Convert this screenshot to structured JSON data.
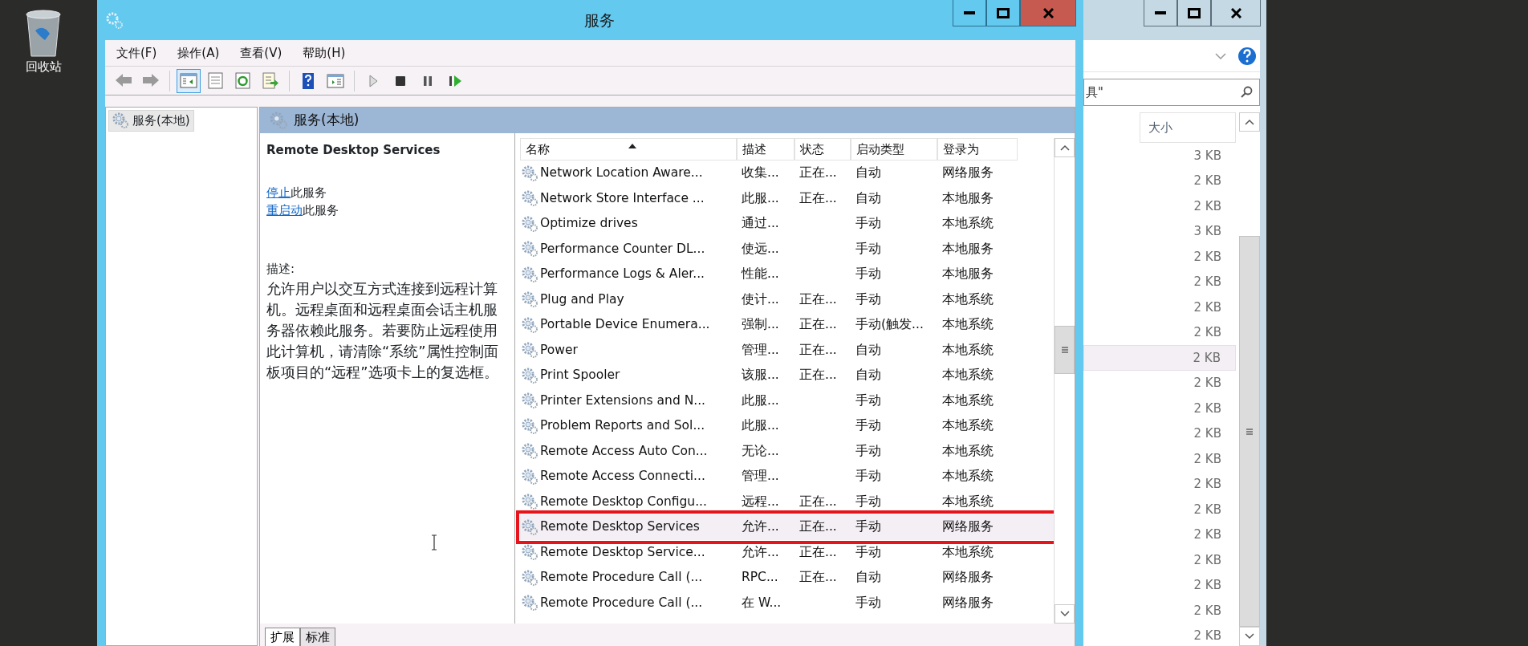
{
  "desktop": {
    "icons": [
      {
        "label": "回收站"
      }
    ]
  },
  "services_window": {
    "title": "服务",
    "menu": [
      "文件(F)",
      "操作(A)",
      "查看(V)",
      "帮助(H)"
    ],
    "toolbar": [
      {
        "kind": "back",
        "pressed": false
      },
      {
        "kind": "forward",
        "pressed": false
      },
      {
        "kind": "tree",
        "pressed": true
      },
      {
        "kind": "properties",
        "pressed": false
      },
      {
        "kind": "refresh",
        "pressed": false
      },
      {
        "kind": "export",
        "pressed": false
      },
      {
        "kind": "help",
        "pressed": false
      },
      {
        "kind": "console",
        "pressed": false
      },
      {
        "kind": "start",
        "pressed": false
      },
      {
        "kind": "stop",
        "pressed": false
      },
      {
        "kind": "pause",
        "pressed": false
      },
      {
        "kind": "resume",
        "pressed": false
      }
    ],
    "tree": [
      {
        "label": "服务(本地)",
        "selected": true
      }
    ],
    "panel_title": "服务(本地)",
    "details": {
      "service_name": "Remote Desktop Services",
      "actions": [
        {
          "link": "停止",
          "text": "此服务"
        },
        {
          "link": "重启动",
          "text": "此服务"
        }
      ],
      "description_label": "描述:",
      "description": "允许用户以交互方式连接到远程计算机。远程桌面和远程桌面会话主机服务器依赖此服务。若要防止远程使用此计算机，请清除“系统”属性控制面板项目的“远程”选项卡上的复选框。"
    },
    "table": {
      "columns": [
        {
          "label": "名称",
          "sorted": true
        },
        {
          "label": "描述",
          "sorted": false
        },
        {
          "label": "状态",
          "sorted": false
        },
        {
          "label": "启动类型",
          "sorted": false
        },
        {
          "label": "登录为",
          "sorted": false
        }
      ],
      "rows": [
        {
          "name": "Network Location Aware...",
          "description": "收集...",
          "status": "正在...",
          "startup_type": "自动",
          "log_on_as": "网络服务",
          "selected": false,
          "highlighted": false
        },
        {
          "name": "Network Store Interface ...",
          "description": "此服...",
          "status": "正在...",
          "startup_type": "自动",
          "log_on_as": "本地服务",
          "selected": false,
          "highlighted": false
        },
        {
          "name": "Optimize drives",
          "description": "通过...",
          "startup_type": "手动",
          "log_on_as": "本地系统",
          "selected": false,
          "highlighted": false
        },
        {
          "name": "Performance Counter DL...",
          "description": "使远...",
          "startup_type": "手动",
          "log_on_as": "本地服务",
          "selected": false,
          "highlighted": false
        },
        {
          "name": "Performance Logs & Aler...",
          "description": "性能...",
          "startup_type": "手动",
          "log_on_as": "本地服务",
          "selected": false,
          "highlighted": false
        },
        {
          "name": "Plug and Play",
          "description": "使计...",
          "status": "正在...",
          "startup_type": "手动",
          "log_on_as": "本地系统",
          "selected": false,
          "highlighted": false
        },
        {
          "name": "Portable Device Enumera...",
          "description": "强制...",
          "status": "正在...",
          "startup_type": "手动(触发...",
          "log_on_as": "本地系统",
          "selected": false,
          "highlighted": false
        },
        {
          "name": "Power",
          "description": "管理...",
          "status": "正在...",
          "startup_type": "自动",
          "log_on_as": "本地系统",
          "selected": false,
          "highlighted": false
        },
        {
          "name": "Print Spooler",
          "description": "该服...",
          "status": "正在...",
          "startup_type": "自动",
          "log_on_as": "本地系统",
          "selected": false,
          "highlighted": false
        },
        {
          "name": "Printer Extensions and N...",
          "description": "此服...",
          "startup_type": "手动",
          "log_on_as": "本地系统",
          "selected": false,
          "highlighted": false
        },
        {
          "name": "Problem Reports and Sol...",
          "description": "此服...",
          "startup_type": "手动",
          "log_on_as": "本地系统",
          "selected": false,
          "highlighted": false
        },
        {
          "name": "Remote Access Auto Con...",
          "description": "无论...",
          "startup_type": "手动",
          "log_on_as": "本地系统",
          "selected": false,
          "highlighted": false
        },
        {
          "name": "Remote Access Connecti...",
          "description": "管理...",
          "startup_type": "手动",
          "log_on_as": "本地系统",
          "selected": false,
          "highlighted": false
        },
        {
          "name": "Remote Desktop Configu...",
          "description": "远程...",
          "status": "正在...",
          "startup_type": "手动",
          "log_on_as": "本地系统",
          "selected": false,
          "highlighted": false
        },
        {
          "name": "Remote Desktop Services",
          "description": "允许...",
          "status": "正在...",
          "startup_type": "手动",
          "log_on_as": "网络服务",
          "selected": true,
          "highlighted": true
        },
        {
          "name": "Remote Desktop Service...",
          "description": "允许...",
          "status": "正在...",
          "startup_type": "手动",
          "log_on_as": "本地系统",
          "selected": false,
          "highlighted": false
        },
        {
          "name": "Remote Procedure Call (...",
          "description": "RPC...",
          "status": "正在...",
          "startup_type": "自动",
          "log_on_as": "网络服务",
          "selected": false,
          "highlighted": false
        },
        {
          "name": "Remote Procedure Call (...",
          "description": "在 W...",
          "startup_type": "手动",
          "log_on_as": "网络服务",
          "selected": false,
          "highlighted": false
        }
      ]
    },
    "bottom_tabs": [
      {
        "label": "扩展",
        "selected": true
      },
      {
        "label": "标准",
        "selected": false
      }
    ]
  },
  "explorer_window": {
    "search": {
      "value": "具\""
    },
    "columns": [
      "大小"
    ],
    "sizes": [
      {
        "text": "3 KB",
        "selected": false
      },
      {
        "text": "2 KB",
        "selected": false
      },
      {
        "text": "2 KB",
        "selected": false
      },
      {
        "text": "3 KB",
        "selected": false
      },
      {
        "text": "2 KB",
        "selected": false
      },
      {
        "text": "2 KB",
        "selected": false
      },
      {
        "text": "2 KB",
        "selected": false
      },
      {
        "text": "2 KB",
        "selected": false
      },
      {
        "text": "2 KB",
        "selected": true
      },
      {
        "text": "2 KB",
        "selected": false
      },
      {
        "text": "2 KB",
        "selected": false
      },
      {
        "text": "2 KB",
        "selected": false
      },
      {
        "text": "2 KB",
        "selected": false
      },
      {
        "text": "2 KB",
        "selected": false
      },
      {
        "text": "2 KB",
        "selected": false
      },
      {
        "text": "2 KB",
        "selected": false
      },
      {
        "text": "2 KB",
        "selected": false
      },
      {
        "text": "2 KB",
        "selected": false
      },
      {
        "text": "2 KB",
        "selected": false
      },
      {
        "text": "2 KB",
        "selected": false
      }
    ]
  }
}
